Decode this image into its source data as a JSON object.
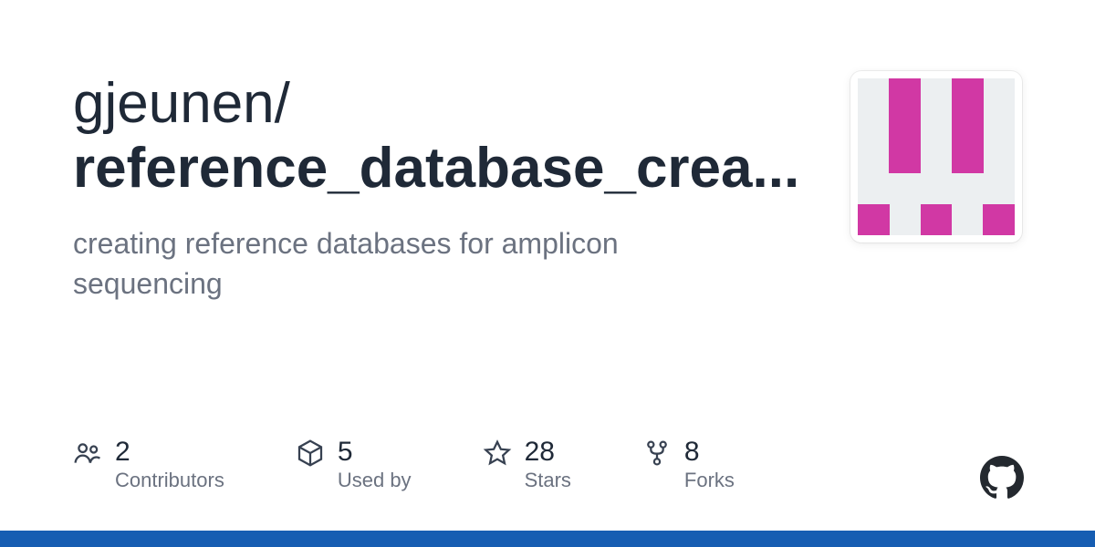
{
  "repo": {
    "owner": "gjeunen",
    "name_display": "reference_database_crea...",
    "description": "creating reference databases for amplicon sequencing"
  },
  "stats": {
    "contributors": {
      "value": "2",
      "label": "Contributors"
    },
    "used_by": {
      "value": "5",
      "label": "Used by"
    },
    "stars": {
      "value": "28",
      "label": "Stars"
    },
    "forks": {
      "value": "8",
      "label": "Forks"
    }
  },
  "colors": {
    "language_bar": "#165db2",
    "identicon": "#d138a4"
  }
}
